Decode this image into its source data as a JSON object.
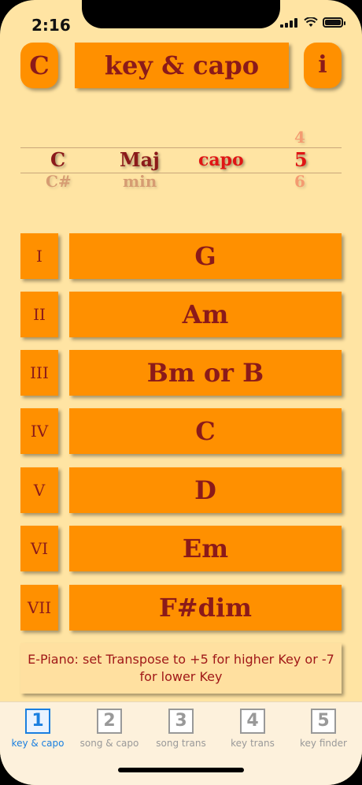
{
  "status": {
    "time": "2:16"
  },
  "header": {
    "key_label": "C",
    "title": "key & capo",
    "info_label": "i"
  },
  "picker": {
    "key": {
      "selected": "C",
      "below": "C#"
    },
    "mode": {
      "selected": "Maj",
      "below": "min"
    },
    "capo_label": "capo",
    "capo": {
      "above": "4",
      "selected": "5",
      "below": "6"
    }
  },
  "rows": [
    {
      "numeral": "I",
      "chord": "G"
    },
    {
      "numeral": "II",
      "chord": "Am"
    },
    {
      "numeral": "III",
      "chord": "Bm or B"
    },
    {
      "numeral": "IV",
      "chord": "C"
    },
    {
      "numeral": "V",
      "chord": "D"
    },
    {
      "numeral": "VI",
      "chord": "Em"
    },
    {
      "numeral": "VII",
      "chord": "F#dim"
    }
  ],
  "note": "E-Piano: set Transpose to +5 for higher Key or -7 for lower Key",
  "tabs": [
    {
      "icon": "1",
      "label": "key & capo",
      "active": true
    },
    {
      "icon": "2",
      "label": "song & capo",
      "active": false
    },
    {
      "icon": "3",
      "label": "song trans",
      "active": false
    },
    {
      "icon": "4",
      "label": "key trans",
      "active": false
    },
    {
      "icon": "5",
      "label": "key finder",
      "active": false
    }
  ],
  "colors": {
    "background": "#ffe4a3",
    "button": "#ff9000",
    "text": "#8b1a1a",
    "accent_red": "#e01515",
    "tab_active": "#1a7fe0"
  }
}
